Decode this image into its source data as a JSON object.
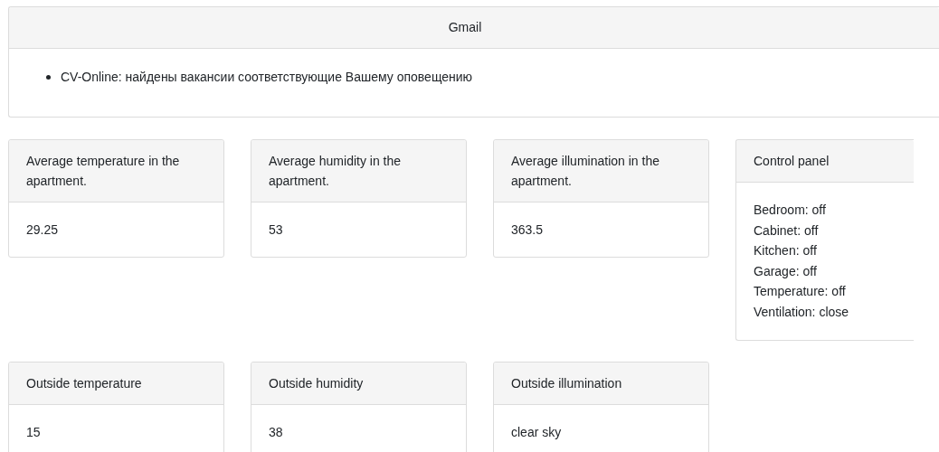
{
  "gmail": {
    "title": "Gmail",
    "items": [
      "CV-Online: найдены вакансии соответствующие Вашему оповещению"
    ]
  },
  "rows": [
    [
      {
        "kind": "value",
        "title": "Average temperature in the apartment.",
        "value": "29.25"
      },
      {
        "kind": "value",
        "title": "Average humidity in the apartment.",
        "value": "53"
      },
      {
        "kind": "value",
        "title": "Average illumination in the apartment.",
        "value": "363.5"
      },
      {
        "kind": "lines",
        "title": "Control panel",
        "lines": [
          "Bedroom: off",
          "Cabinet: off",
          "Kitchen: off",
          "Garage: off",
          "Temperature: off",
          "Ventilation: close"
        ]
      }
    ],
    [
      {
        "kind": "value",
        "title": "Outside temperature",
        "value": "15"
      },
      {
        "kind": "value",
        "title": "Outside humidity",
        "value": "38"
      },
      {
        "kind": "value",
        "title": "Outside illumination",
        "value": "clear sky"
      }
    ]
  ]
}
